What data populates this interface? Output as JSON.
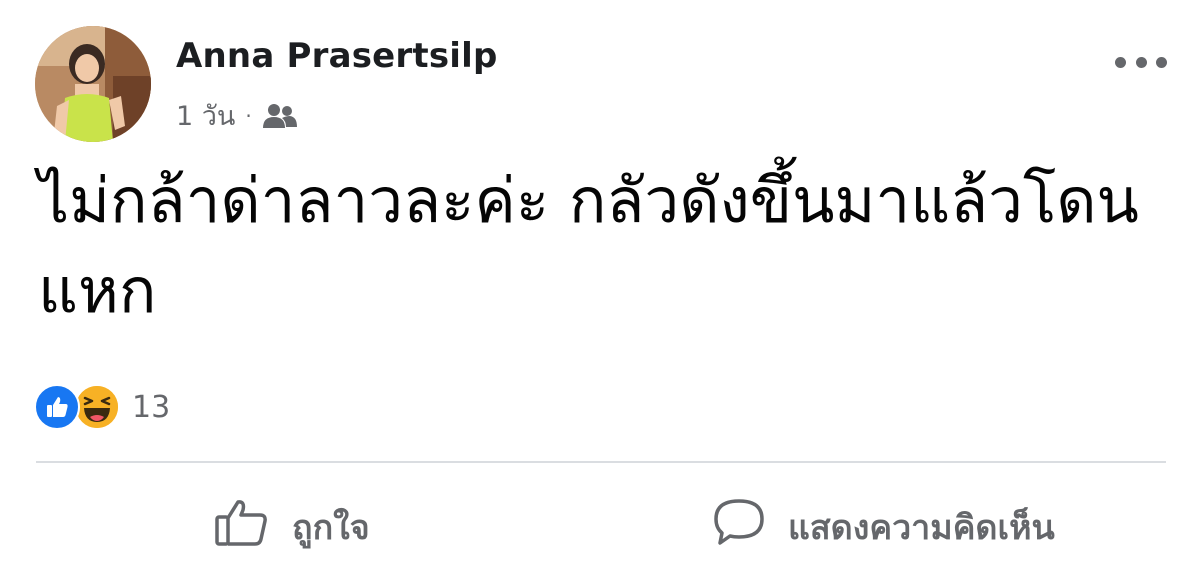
{
  "post": {
    "author": "Anna Prasertsilp",
    "time": "1 วัน",
    "separator": "·",
    "audience_icon": "friends-icon",
    "text": "ไม่กล้าด่าลาวละค่ะ กลัวดังขึ้นมาแล้วโดนแหก",
    "reactions": {
      "types": [
        "like",
        "haha"
      ],
      "count": "13"
    },
    "actions": {
      "like_label": "ถูกใจ",
      "comment_label": "แสดงความคิดเห็น"
    },
    "colors": {
      "like_blue": "#1877f2",
      "haha_yellow": "#f7b125",
      "secondary_text": "#65676b",
      "divider": "#dadde1"
    }
  }
}
